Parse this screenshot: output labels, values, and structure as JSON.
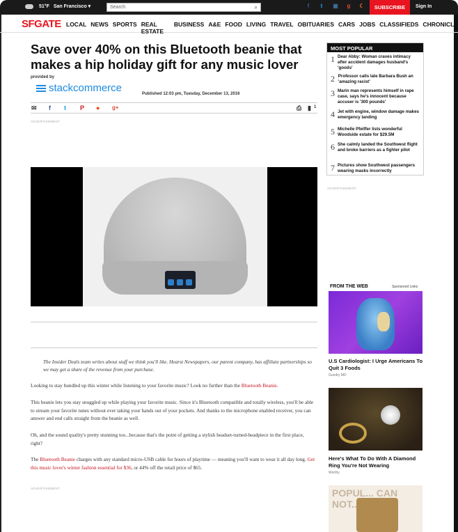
{
  "topbar": {
    "temperature": "51°F",
    "city": "San Francisco ▾",
    "search_placeholder": "Search",
    "subscribe": "SUBSCRIBE",
    "signin": "Sign In"
  },
  "nav": {
    "logo": "SFGATE",
    "items": [
      "LOCAL",
      "NEWS",
      "SPORTS",
      "REAL ESTATE",
      "BUSINESS",
      "A&E",
      "FOOD",
      "LIVING",
      "TRAVEL",
      "OBITUARIES",
      "CARS",
      "JOBS",
      "CLASSIFIEDS",
      "CHRONICLE"
    ]
  },
  "article": {
    "headline": "Save over 40% on this Bluetooth beanie that makes a hip holiday gift for any music lover",
    "provided_by": "provided by",
    "sponsor": "stackcommerce",
    "published": "Published 12:03 pm, Tuesday, December 13, 2016",
    "comment_count": "1",
    "ad_label": "ADVERTISEMENT",
    "quote": "The Insider Deals team writes about stuff we think you'll like. Hearst Newspapers, our parent company, has affiliate partnerships so we may get a share of the revenue from your purchase.",
    "p1_text": "Looking to stay bundled up this winter while listening to your favorite music? Look no further than the ",
    "p1_link": "Bluetooth Beanie",
    "p1_end": ".",
    "p2": "This beanie lets you stay snuggled up while playing your favorite music. Since it's Bluetooth compatible and totally wireless, you'll be able to stream your favorite tunes without ever taking your hands out of your pockets. And thanks to the microphone enabled receiver, you can answer and end calls straight from the beanie as well.",
    "p3": "Oh, and the sound quality's pretty stunning too...because that's the point of getting a stylish headset-turned-headpiece in the first place, right?",
    "p4_start": "The ",
    "p4_link1": "Bluetooth Beanie",
    "p4_mid": " charges with any standard micro-USB cable for hours of playtime — meaning you'll want to wear it all day long. ",
    "p4_link2": "Get this music lover's winter fashion essential for $36",
    "p4_end": ", or 44% off the retail price of $65."
  },
  "most_popular": {
    "title": "MOST POPULAR",
    "items": [
      {
        "num": "1",
        "text": "Dear Abby: Woman craves intimacy after accident damages husband's 'goods'"
      },
      {
        "num": "2",
        "text": "Professor calls late Barbara Bush an 'amazing racist'"
      },
      {
        "num": "3",
        "text": "Marin man represents himself in rape case, says he's innocent because accuser is '300 pounds'"
      },
      {
        "num": "4",
        "text": "Jet with engine, window damage makes emergency landing"
      },
      {
        "num": "5",
        "text": "Michelle Pfeiffer lists wonderful Woodside estate for $29.5M"
      },
      {
        "num": "6",
        "text": "She calmly landed the Southwest flight and broke barriers as a fighter pilot"
      },
      {
        "num": "7",
        "text": "Pictures show Southwest passengers wearing masks incorrectly"
      }
    ]
  },
  "sidebar": {
    "ad_label": "ADVERTISEMENT",
    "from_the_web": "FROM THE WEB",
    "sponsored": "Sponsored Links",
    "ads": [
      {
        "title": "U.S Cardiologist: I Urge Americans To Quit 3 Foods",
        "source": "Gundry MD"
      },
      {
        "title": "Here's What To Do With A Diamond Ring You're Not Wearing",
        "source": "Worthy"
      },
      {
        "overlay": "POPUL... CAN NOT..."
      }
    ]
  },
  "colors": {
    "brand_red": "#e8141f",
    "link_red": "#c4121a",
    "stack_blue": "#1c8ae0"
  }
}
